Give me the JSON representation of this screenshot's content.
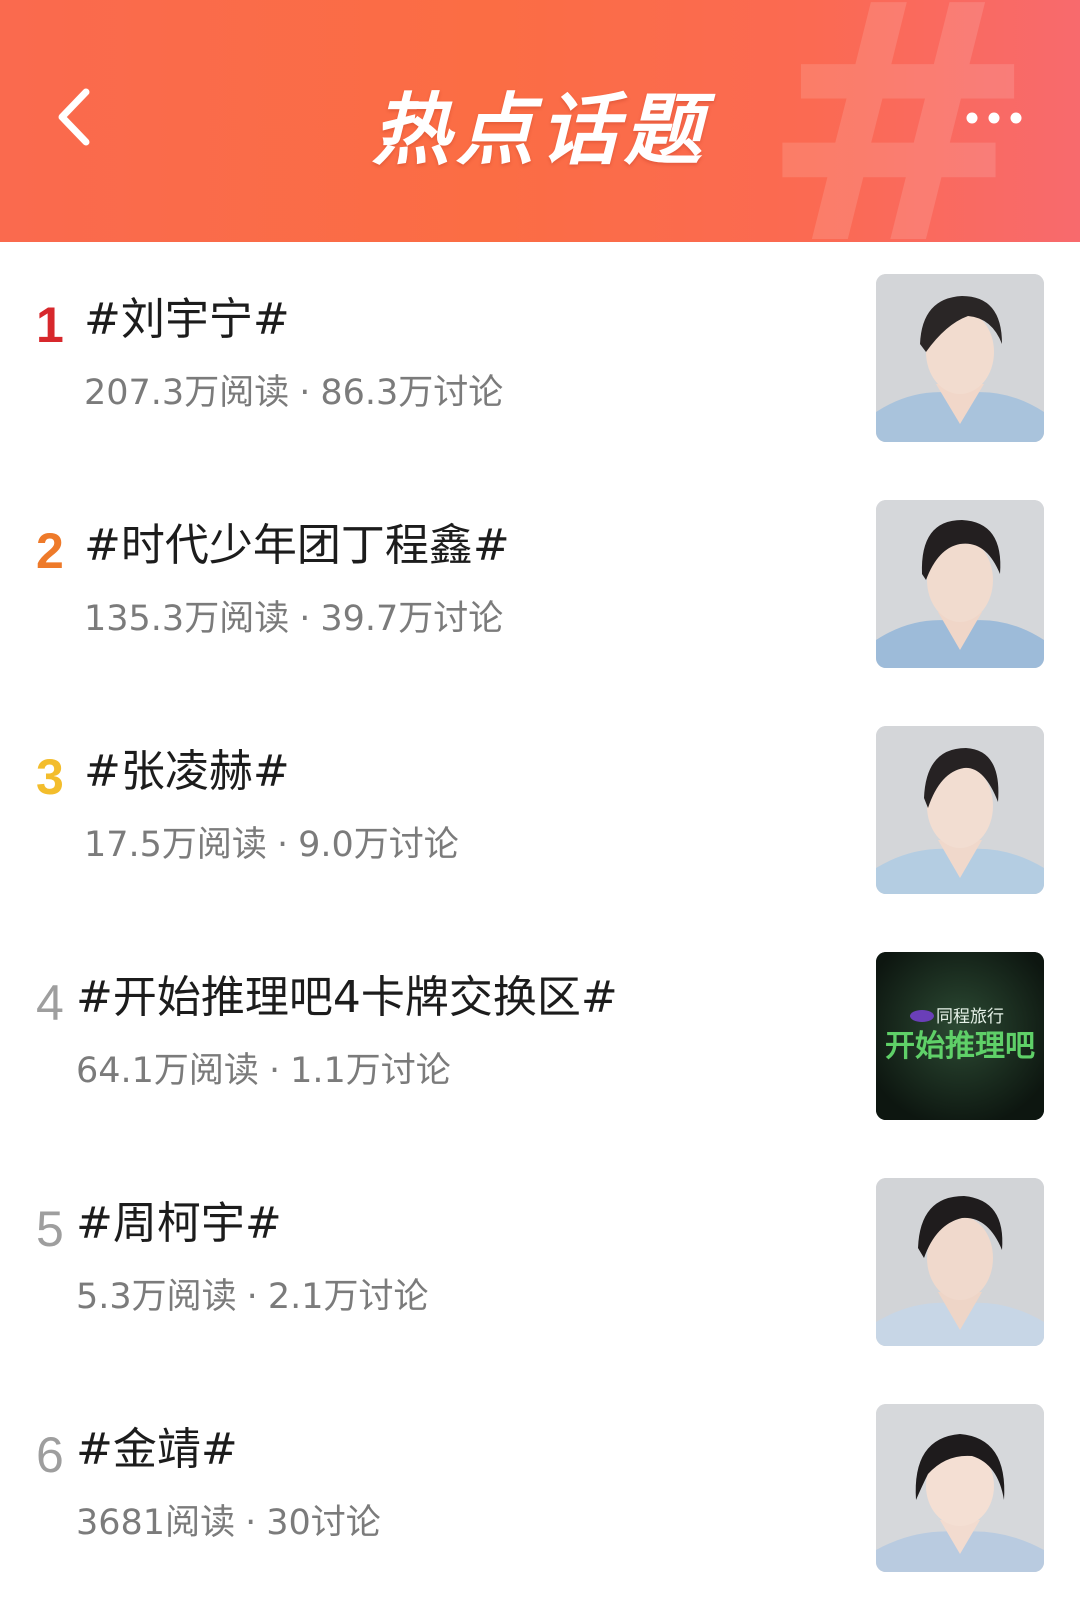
{
  "header": {
    "title": "热点话题",
    "back_icon": "chevron-left-icon",
    "more_icon": "more-horizontal-icon"
  },
  "colors": {
    "header_orange": "#fb6d44",
    "rank_1": "#d7282c",
    "rank_2": "#ee7a2a",
    "rank_3": "#f3bd2c",
    "rank_other": "#9e9e9e"
  },
  "topics": [
    {
      "rank": "1",
      "title": "#刘宇宁#",
      "reads": "207.3万阅读",
      "discussions": "86.3万讨论"
    },
    {
      "rank": "2",
      "title": "#时代少年团丁程鑫#",
      "reads": "135.3万阅读",
      "discussions": "39.7万讨论"
    },
    {
      "rank": "3",
      "title": "#张凌赫#",
      "reads": "17.5万阅读",
      "discussions": "9.0万讨论"
    },
    {
      "rank": "4",
      "title": "#开始推理吧4卡牌交换区#",
      "reads": "64.1万阅读",
      "discussions": "1.1万讨论",
      "thumb_text": {
        "brand": "同程旅行",
        "show": "开始推理吧"
      }
    },
    {
      "rank": "5",
      "title": "#周柯宇#",
      "reads": "5.3万阅读",
      "discussions": "2.1万讨论"
    },
    {
      "rank": "6",
      "title": "#金靖#",
      "reads": "3681阅读",
      "discussions": "30讨论"
    }
  ],
  "separator": "·"
}
